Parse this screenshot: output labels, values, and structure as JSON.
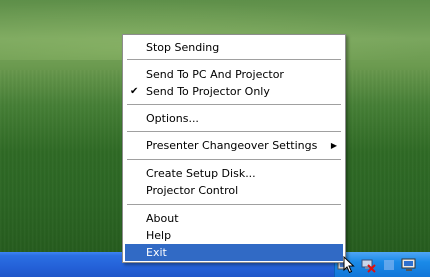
{
  "menu": {
    "items": [
      {
        "label": "Stop Sending"
      },
      {
        "label": "Send To PC And Projector"
      },
      {
        "label": "Send To Projector Only",
        "checked": true,
        "check_glyph": "✔"
      },
      {
        "label": "Options..."
      },
      {
        "label": "Presenter Changeover Settings",
        "has_submenu": true,
        "submenu_glyph": "▶"
      },
      {
        "label": "Create Setup Disk..."
      },
      {
        "label": "Projector Control"
      },
      {
        "label": "About"
      },
      {
        "label": "Help"
      },
      {
        "label": "Exit",
        "highlighted": true
      }
    ]
  },
  "tray": {
    "icons": [
      "projector-app-icon",
      "network-disconnected-icon",
      "volume-icon",
      "display-icon"
    ]
  },
  "colors": {
    "highlight": "#316ac5",
    "taskbar": "#2461d8",
    "tray": "#1a8ae8"
  }
}
